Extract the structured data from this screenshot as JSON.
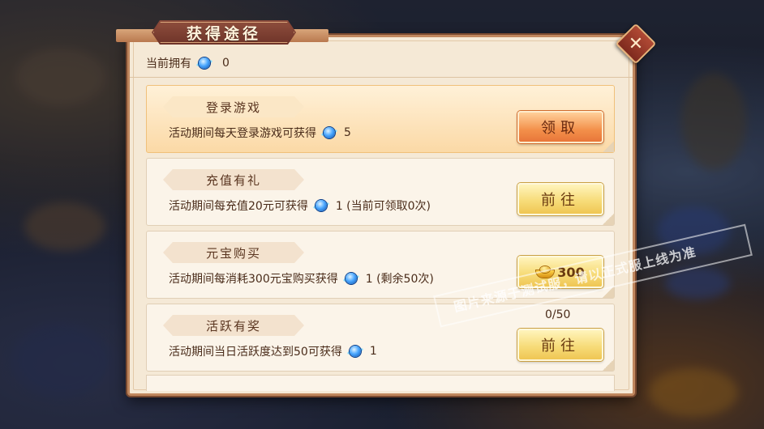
{
  "dialog": {
    "title": "获得途径",
    "close_icon": "close-x-icon"
  },
  "currency": {
    "label": "当前拥有",
    "icon": "blue-gem-icon",
    "amount": "0"
  },
  "tasks": [
    {
      "name": "登录游戏",
      "desc": "活动期间每天登录游戏可获得",
      "reward": "5",
      "button": "领取",
      "highlighted": true
    },
    {
      "name": "充值有礼",
      "desc": "活动期间每充值20元可获得",
      "reward": "1 (当前可领取0次)",
      "button": "前往",
      "highlighted": false
    },
    {
      "name": "元宝购买",
      "desc": "活动期间每消耗300元宝购买获得",
      "reward": "1 (剩余50次)",
      "button": "300",
      "button_icon": "gold-ingot-icon",
      "highlighted": false
    },
    {
      "name": "活跃有奖",
      "desc": "活动期间当日活跃度达到50可获得",
      "reward": "1",
      "button": "前往",
      "progress": "0/50",
      "highlighted": false
    }
  ],
  "watermark": "图片来源于测试服，请以正式服上线为准",
  "colors": {
    "panel": "#f5e9d6",
    "title_plaque": "#7a3a2e",
    "claim_button": "#f3904a",
    "go_button": "#f7dc7a",
    "text": "#4a2c1a"
  }
}
